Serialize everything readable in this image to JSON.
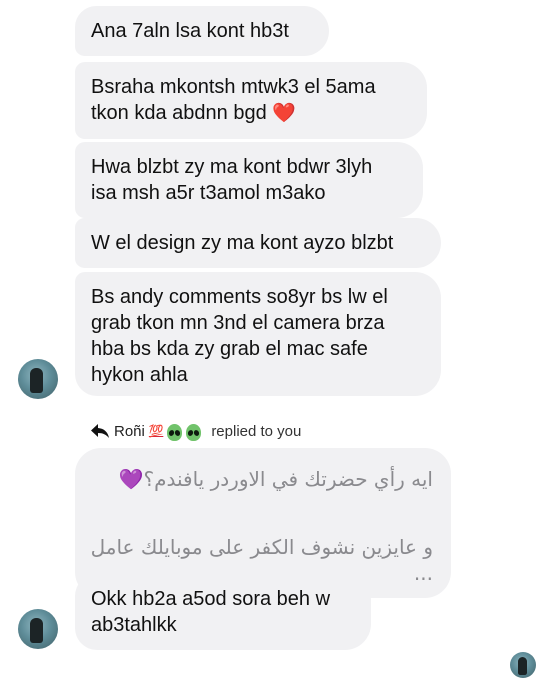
{
  "messages": [
    {
      "text": "Ana 7aln lsa kont hb3t"
    },
    {
      "text": "Bsraha mkontsh mtwk3 el 5ama\ntkon kda abdnn bgd ",
      "emoji": "❤️"
    },
    {
      "text": "Hwa blzbt zy ma kont bdwr 3lyh\nisa msh a5r t3amol m3ako"
    },
    {
      "text": "W el design zy ma kont ayzo blzbt"
    },
    {
      "text": "Bs andy comments so8yr bs lw el\ngrab tkon mn 3nd el camera brza\nhba bs kda zy grab el mac safe\nhykon ahla"
    }
  ],
  "reply": {
    "sender": "Roñi",
    "badge": "💯",
    "replied_label": "replied to you",
    "icons": [
      "reply-arrow-icon",
      "alien-icon",
      "alien-icon"
    ]
  },
  "quoted": {
    "line1": "ايه رأي حضرتك في الاوردر يافندم؟",
    "line1_emoji": "💜",
    "line2": "و عايزين نشوف الكفر على موبايلك عامل ..."
  },
  "reply_message": {
    "text": "Okk hb2a a5od sora beh w\nab3tahlkk"
  },
  "colors": {
    "bubble": "#f1f1f3",
    "text": "#111111",
    "quoted_text": "#8a8a8e"
  }
}
